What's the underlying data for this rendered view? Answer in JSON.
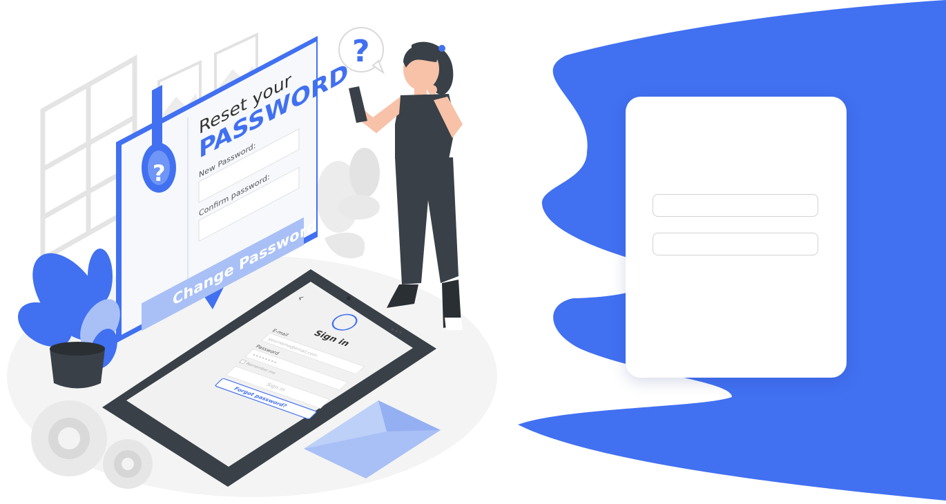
{
  "colors": {
    "accent": "#4170f1",
    "accent_light": "#a9c0f6",
    "dark": "#394047",
    "light_gray": "#ebebeb",
    "card": "#ffffff"
  },
  "illustration": {
    "reset_title_line1": "Reset your",
    "reset_title_line2": "PASSWORD",
    "new_password_label": "New Password:",
    "confirm_password_label": "Confirm password:",
    "change_password_button": "Change Password",
    "question_mark": "?",
    "phone": {
      "title": "Sign in",
      "email_label": "E-mail",
      "email_value": "yourname@email.com",
      "password_label": "Password",
      "password_value": "••••••••",
      "remember_label": "Remember me",
      "sign_in_button": "Sign in",
      "forgot_password_link": "Forgot password?",
      "back_icon": "‹",
      "menu_icon": "•••"
    }
  },
  "form": {
    "field1": {
      "value": "",
      "placeholder": ""
    },
    "field2": {
      "value": "",
      "placeholder": ""
    }
  }
}
